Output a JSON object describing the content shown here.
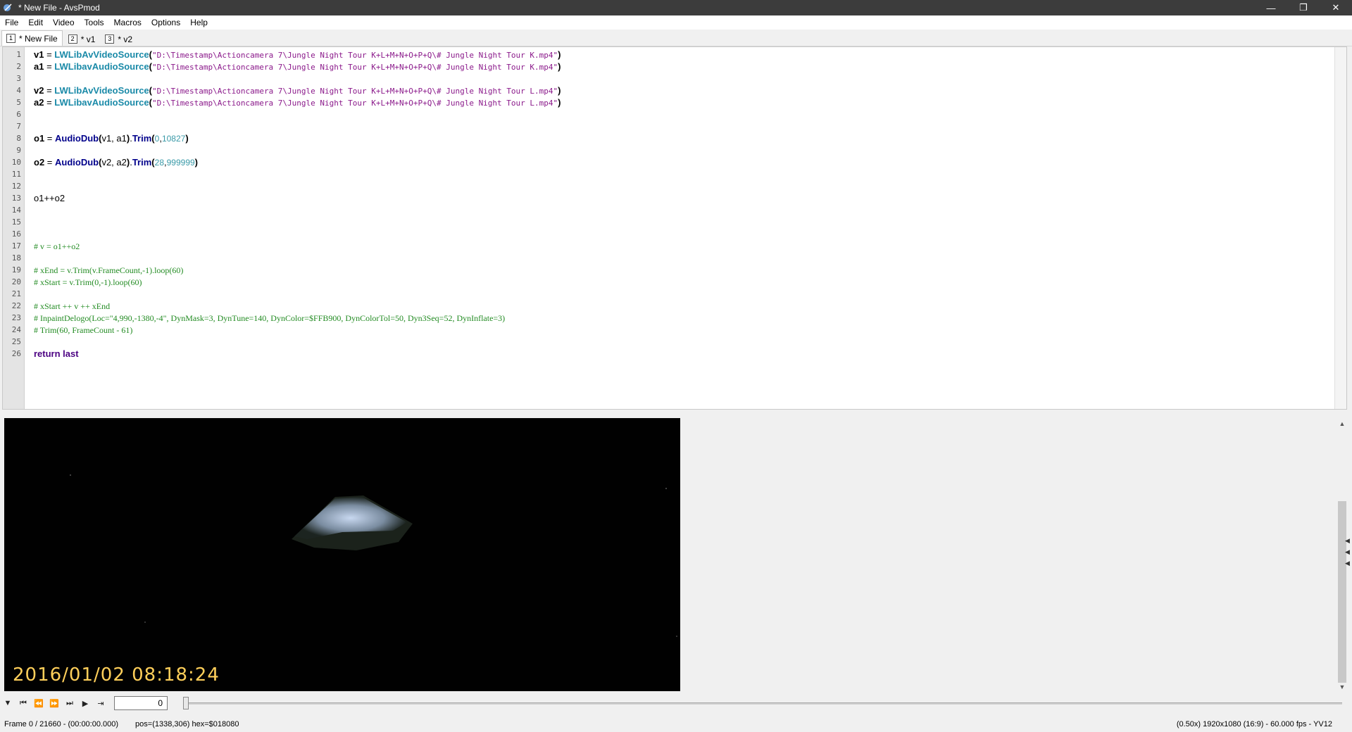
{
  "window": {
    "title": "* New File - AvsPmod",
    "minimize": "—",
    "restore": "❐",
    "close": "✕"
  },
  "menu": [
    "File",
    "Edit",
    "Video",
    "Tools",
    "Macros",
    "Options",
    "Help"
  ],
  "tabs": [
    {
      "num": "1",
      "label": "* New File",
      "active": true
    },
    {
      "num": "2",
      "label": "* v1",
      "active": false
    },
    {
      "num": "3",
      "label": "* v2",
      "active": false
    }
  ],
  "code_lines": [
    {
      "n": "1",
      "tokens": [
        [
          "var",
          "v1"
        ],
        [
          "plain",
          " = "
        ],
        [
          "fn",
          "LWLibAvVideoSource"
        ],
        [
          "paren",
          "("
        ],
        [
          "str",
          "\"D:\\Timestamp\\Actioncamera 7\\Jungle Night Tour K+L+M+N+O+P+Q\\# Jungle Night Tour K.mp4\""
        ],
        [
          "paren",
          ")"
        ]
      ]
    },
    {
      "n": "2",
      "tokens": [
        [
          "var",
          "a1"
        ],
        [
          "plain",
          " = "
        ],
        [
          "fn",
          "LWLibavAudioSource"
        ],
        [
          "paren",
          "("
        ],
        [
          "str",
          "\"D:\\Timestamp\\Actioncamera 7\\Jungle Night Tour K+L+M+N+O+P+Q\\# Jungle Night Tour K.mp4\""
        ],
        [
          "paren",
          ")"
        ]
      ]
    },
    {
      "n": "3",
      "tokens": []
    },
    {
      "n": "4",
      "tokens": [
        [
          "var",
          "v2"
        ],
        [
          "plain",
          " = "
        ],
        [
          "fn",
          "LWLibAvVideoSource"
        ],
        [
          "paren",
          "("
        ],
        [
          "str",
          "\"D:\\Timestamp\\Actioncamera 7\\Jungle Night Tour K+L+M+N+O+P+Q\\# Jungle Night Tour L.mp4\""
        ],
        [
          "paren",
          ")"
        ]
      ]
    },
    {
      "n": "5",
      "tokens": [
        [
          "var",
          "a2"
        ],
        [
          "plain",
          " = "
        ],
        [
          "fn",
          "LWLibavAudioSource"
        ],
        [
          "paren",
          "("
        ],
        [
          "str",
          "\"D:\\Timestamp\\Actioncamera 7\\Jungle Night Tour K+L+M+N+O+P+Q\\# Jungle Night Tour L.mp4\""
        ],
        [
          "paren",
          ")"
        ]
      ]
    },
    {
      "n": "6",
      "tokens": []
    },
    {
      "n": "7",
      "tokens": []
    },
    {
      "n": "8",
      "tokens": [
        [
          "var",
          "o1"
        ],
        [
          "plain",
          " = "
        ],
        [
          "fn2",
          "AudioDub"
        ],
        [
          "paren",
          "("
        ],
        [
          "plain",
          "v1, a1"
        ],
        [
          "paren",
          ")"
        ],
        [
          "plain",
          "."
        ],
        [
          "fn2",
          "Trim"
        ],
        [
          "paren",
          "("
        ],
        [
          "num",
          "0"
        ],
        [
          "plain",
          ","
        ],
        [
          "num",
          "10827"
        ],
        [
          "paren",
          ")"
        ]
      ]
    },
    {
      "n": "9",
      "tokens": []
    },
    {
      "n": "10",
      "tokens": [
        [
          "var",
          "o2"
        ],
        [
          "plain",
          " = "
        ],
        [
          "fn2",
          "AudioDub"
        ],
        [
          "paren",
          "("
        ],
        [
          "plain",
          "v2, a2"
        ],
        [
          "paren",
          ")"
        ],
        [
          "plain",
          "."
        ],
        [
          "fn2",
          "Trim"
        ],
        [
          "paren",
          "("
        ],
        [
          "num",
          "28"
        ],
        [
          "plain",
          ","
        ],
        [
          "num",
          "999999"
        ],
        [
          "paren",
          ")"
        ]
      ]
    },
    {
      "n": "11",
      "tokens": []
    },
    {
      "n": "12",
      "tokens": []
    },
    {
      "n": "13",
      "tokens": [
        [
          "plain",
          "o1++o2"
        ]
      ]
    },
    {
      "n": "14",
      "tokens": []
    },
    {
      "n": "15",
      "tokens": []
    },
    {
      "n": "16",
      "tokens": []
    },
    {
      "n": "17",
      "tokens": [
        [
          "cmt",
          "# v = o1++o2"
        ]
      ]
    },
    {
      "n": "18",
      "tokens": []
    },
    {
      "n": "19",
      "tokens": [
        [
          "cmt",
          "# xEnd = v.Trim(v.FrameCount,-1).loop(60)"
        ]
      ]
    },
    {
      "n": "20",
      "tokens": [
        [
          "cmt",
          "# xStart = v.Trim(0,-1).loop(60)"
        ]
      ]
    },
    {
      "n": "21",
      "tokens": []
    },
    {
      "n": "22",
      "tokens": [
        [
          "cmt",
          "# xStart ++ v ++ xEnd"
        ]
      ]
    },
    {
      "n": "23",
      "tokens": [
        [
          "cmt",
          "# InpaintDelogo(Loc=\"4,990,-1380,-4\", DynMask=3, DynTune=140, DynColor=$FFB900, DynColorTol=50, Dyn3Seq=52, DynInflate=3)"
        ]
      ]
    },
    {
      "n": "24",
      "tokens": [
        [
          "cmt",
          "# Trim(60, FrameCount - 61)"
        ]
      ]
    },
    {
      "n": "25",
      "tokens": []
    },
    {
      "n": "26",
      "tokens": [
        [
          "kw",
          "return last"
        ]
      ]
    }
  ],
  "video": {
    "timestamp": "2016/01/02  08:18:24"
  },
  "controls": {
    "frame_value": "0",
    "slider_position": 0,
    "buttons": [
      "menu-toggle",
      "go-first",
      "step-back",
      "step-forward",
      "go-last",
      "play",
      "bookmark"
    ]
  },
  "status": {
    "frame": "Frame 0 / 21660  -  (00:00:00.000)",
    "pos": "pos=(1338,306)  hex=$018080",
    "info": "(0.50x)  1920x1080 (16:9)  -  60.000 fps  -  YV12"
  },
  "colors": {
    "titlebar": "#3c3c3c",
    "string": "#8b1a8b",
    "function": "#1a8aa8",
    "comment": "#228b22",
    "timestamp": "#ffcf5a"
  }
}
